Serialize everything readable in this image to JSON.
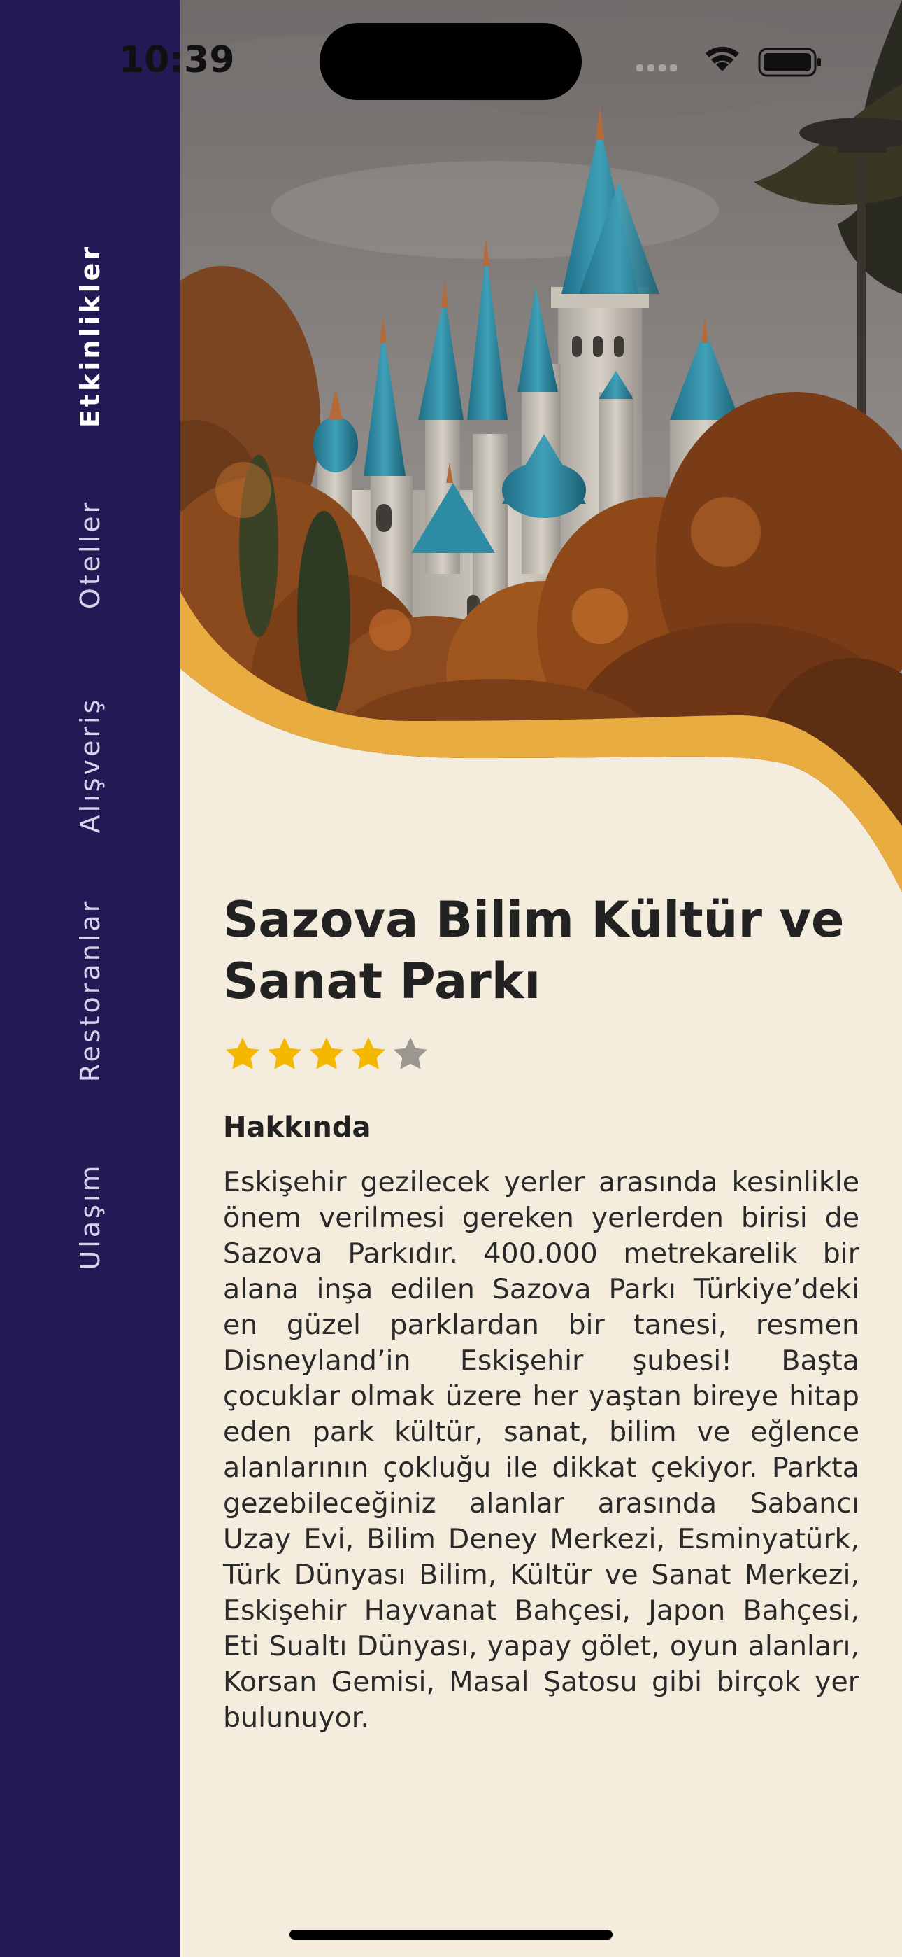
{
  "status_bar": {
    "time": "10:39"
  },
  "sidebar": {
    "items": [
      {
        "label": "Etkinlikler",
        "active": true
      },
      {
        "label": "Oteller",
        "active": false
      },
      {
        "label": "Alışveriş",
        "active": false
      },
      {
        "label": "Restoranlar",
        "active": false
      },
      {
        "label": "Ulaşım",
        "active": false
      }
    ]
  },
  "hero": {
    "image": "castle-photo",
    "accent_color": "#E8AC41"
  },
  "place": {
    "title": "Sazova Bilim Kültür ve Sanat Parkı",
    "rating": 4,
    "rating_max": 5,
    "about_heading": "Hakkında",
    "about_text": "Eskişehir gezilecek yerler arasında kesinlikle önem verilmesi gereken yerlerden birisi de Sazova Parkıdır. 400.000 metrekarelik bir alana inşa edilen Sazova Parkı Türkiye’deki en güzel parklardan bir tanesi, resmen Disneyland’in Eskişehir şubesi! Başta çocuklar olmak üzere her yaştan bireye hitap eden park kültür, sanat, bilim ve eğlence alanlarının çokluğu ile dikkat çekiyor. Parkta gezebileceğiniz alanlar arasında Sabancı Uzay Evi, Bilim Deney Merkezi, Esminyatürk, Türk Dünyası Bilim, Kültür ve Sanat Merkezi, Eskişehir Hayvanat Bahçesi, Japon Bahçesi, Eti Sualtı Dünyası, yapay gölet, oyun alanları, Korsan Gemisi, Masal Şatosu gibi birçok yer bulunuyor."
  },
  "colors": {
    "sidebar_bg": "#231A55",
    "page_bg": "#F4ECDD",
    "star_filled": "#F5B800",
    "star_empty": "#9A9690"
  }
}
